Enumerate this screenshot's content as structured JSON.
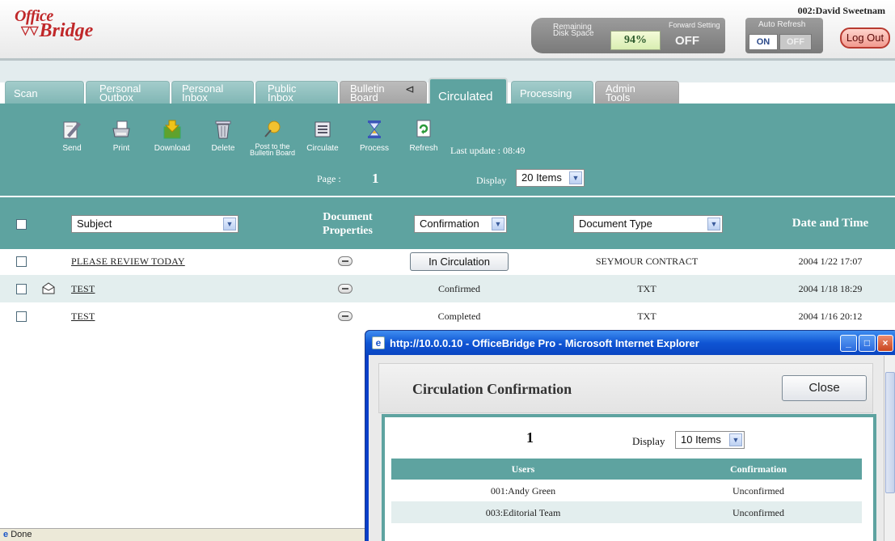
{
  "app": {
    "logo_line1": "Office",
    "logo_line2": "Bridge",
    "user": "002:David Sweetnam"
  },
  "status": {
    "disk_label1": "Remaining",
    "disk_label2": "Disk Space",
    "disk_value": "94%",
    "forward_label": "Forward Setting",
    "forward_value": "OFF",
    "autorefresh_label": "Auto Refresh",
    "on": "ON",
    "off": "OFF",
    "logout": "Log Out"
  },
  "tabs": [
    {
      "label": "Scan"
    },
    {
      "line1": "Personal",
      "line2": "Outbox"
    },
    {
      "line1": "Personal",
      "line2": "Inbox"
    },
    {
      "line1": "Public",
      "line2": "Inbox"
    },
    {
      "line1": "Bulletin",
      "line2": "Board"
    },
    {
      "label": "Circulated"
    },
    {
      "label": "Processing"
    },
    {
      "line1": "Admin",
      "line2": "Tools"
    }
  ],
  "toolbar": {
    "send": "Send",
    "print": "Print",
    "download": "Download",
    "delete": "Delete",
    "post1": "Post to the",
    "post2": "Bulletin Board",
    "circulate": "Circulate",
    "process": "Process",
    "refresh": "Refresh",
    "last_update": "Last update : 08:49",
    "page_label": "Page :",
    "page": "1",
    "display_label": "Display",
    "display_value": "20 Items"
  },
  "table": {
    "subject": "Subject",
    "docprops1": "Document",
    "docprops2": "Properties",
    "confirmation": "Confirmation",
    "doctype": "Document Type",
    "datetime": "Date and Time",
    "rows": [
      {
        "subject": "PLEASE REVIEW TODAY",
        "confirmation": "In Circulation",
        "doctype": "SEYMOUR CONTRACT",
        "date": "2004 1/22 17:07"
      },
      {
        "subject": "TEST",
        "confirmation": "Confirmed",
        "doctype": "TXT",
        "date": "2004 1/18 18:29"
      },
      {
        "subject": "TEST",
        "confirmation": "Completed",
        "doctype": "TXT",
        "date": "2004 1/16 20:12"
      }
    ]
  },
  "statusbar": {
    "text": "Done"
  },
  "popup": {
    "window_title": "http://10.0.0.10 - OfficeBridge Pro - Microsoft Internet Explorer",
    "title": "Circulation Confirmation",
    "close": "Close",
    "page": "1",
    "display_label": "Display",
    "display_value": "10 Items",
    "col_users": "Users",
    "col_confirmation": "Confirmation",
    "rows": [
      {
        "user": "001:Andy Green",
        "status": "Unconfirmed"
      },
      {
        "user": "003:Editorial Team",
        "status": "Unconfirmed"
      }
    ]
  },
  "colors": {
    "teal": "#5ea3a0",
    "logo_red": "#c0282a",
    "row_alt": "#e3eeee"
  }
}
